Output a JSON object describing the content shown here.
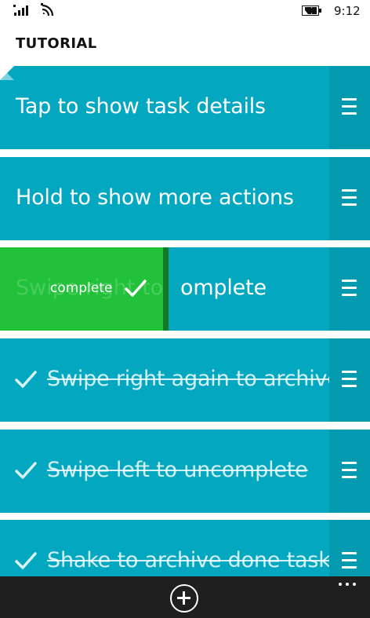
{
  "status_bar": {
    "time": "9:12",
    "icons": [
      "signal-strength-icon",
      "wifi-icon",
      "battery-icon"
    ]
  },
  "page": {
    "title": "TUTORIAL"
  },
  "tasks": [
    {
      "text": "Tap to show task details",
      "state": "active"
    },
    {
      "text": "Hold to show more actions",
      "state": "active"
    },
    {
      "text": "Swipe right to complete",
      "state": "swiping"
    },
    {
      "text": "Swipe right again to archive",
      "state": "completed"
    },
    {
      "text": "Swipe left to uncomplete",
      "state": "completed"
    },
    {
      "text": "Shake to archive done task…",
      "state": "completed"
    }
  ],
  "swipe": {
    "action_label": "complete",
    "visible_rest_text": "omplete"
  },
  "app_bar": {
    "icons": [
      "add-circle-icon",
      "more-ellipsis-icon"
    ]
  },
  "colors": {
    "task_background": "#03a8c0",
    "handle_column": "#0399ae",
    "swipe_complete": "#21c139",
    "app_bar": "#1f1f1f"
  }
}
